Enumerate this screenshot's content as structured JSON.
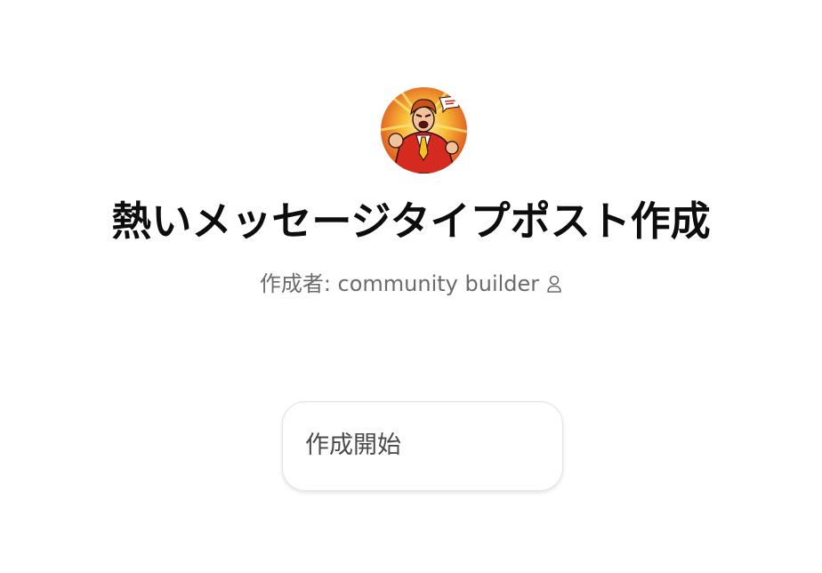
{
  "header": {
    "avatar_icon": "angry-businessman-avatar",
    "title": "熱いメッセージタイプポスト作成",
    "author_text": "作成者: community builder",
    "author_icon": "person-icon"
  },
  "actions": {
    "start_label": "作成開始"
  },
  "colors": {
    "title": "#0d0d0d",
    "author": "#6b6b6b",
    "card_border": "#e2e2e2"
  }
}
